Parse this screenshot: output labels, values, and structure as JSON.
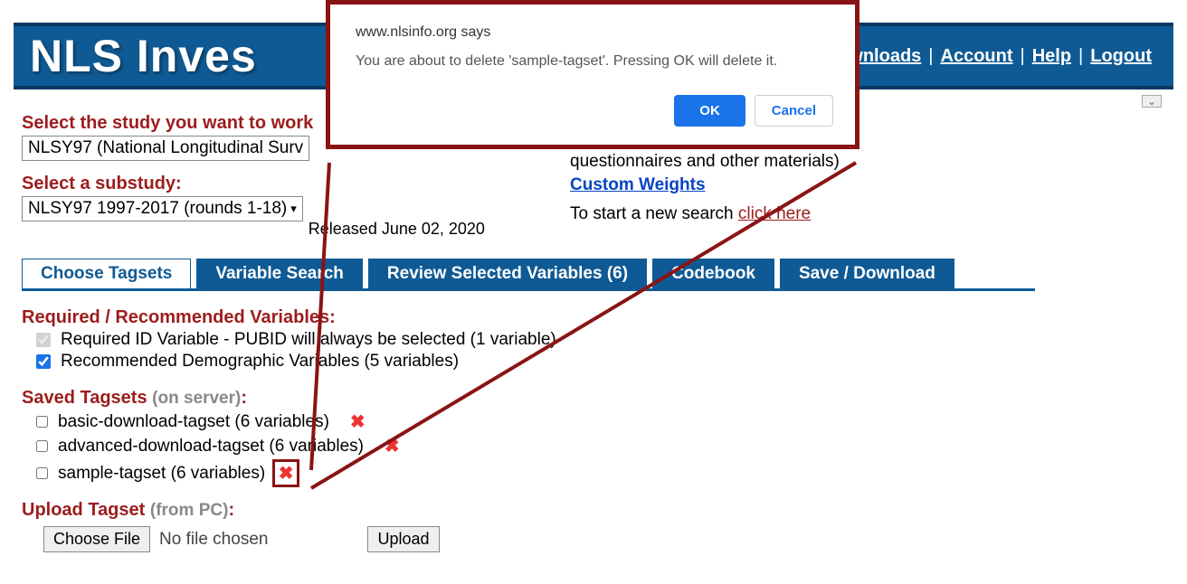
{
  "banner": {
    "title": "NLS Inves",
    "nav": {
      "downloads": "ownloads",
      "account": "Account",
      "help": "Help",
      "logout": "Logout"
    }
  },
  "expand_icon": "⌄",
  "study": {
    "label": "Select the study you want to work ",
    "selected": "NLSY97 (National Longitudinal Surv"
  },
  "substudy": {
    "label": "Select a substudy:",
    "selected": "NLSY97 1997-2017 (rounds 1-18)",
    "released": "Released June 02, 2020"
  },
  "right": {
    "heading": "",
    "paren_text": " questionnaires and other materials)",
    "custom_weights": "Custom Weights",
    "start_label": "To start a new search ",
    "start_link": "click here"
  },
  "tabs": {
    "choose": "Choose Tagsets",
    "search": "Variable Search",
    "review": "Review Selected Variables (6)",
    "codebook": "Codebook",
    "save": "Save / Download"
  },
  "required": {
    "heading": "Required / Recommended Variables:",
    "item1": "Required ID Variable - PUBID will always be selected (1 variable)",
    "item2": "Recommended Demographic Variables (5 variables)"
  },
  "saved": {
    "heading_a": "Saved Tagsets ",
    "heading_b": "(on server)",
    "colon": ":",
    "items": [
      {
        "label": "basic-download-tagset (6 variables)"
      },
      {
        "label": "advanced-download-tagset (6 variables)"
      },
      {
        "label": "sample-tagset (6 variables)"
      }
    ]
  },
  "upload": {
    "heading_a": "Upload Tagset ",
    "heading_b": "(from PC)",
    "colon": ":",
    "choose": "Choose File",
    "nofile": "No file chosen",
    "upload": "Upload"
  },
  "dialog": {
    "origin": "www.nlsinfo.org says",
    "message": "You are about to delete 'sample-tagset'.  Pressing OK will delete it.",
    "ok": "OK",
    "cancel": "Cancel"
  }
}
